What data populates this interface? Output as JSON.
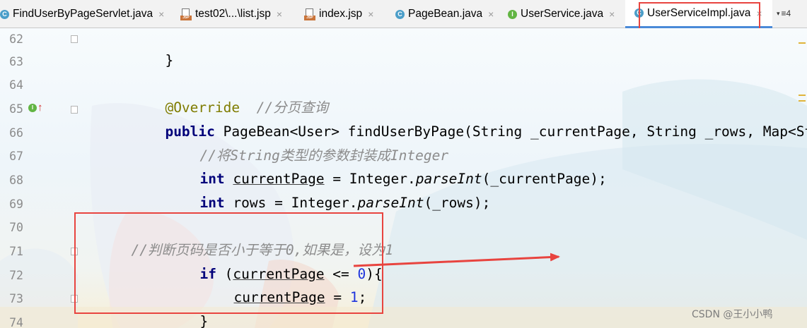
{
  "tabs": [
    {
      "label": "FindUserByPageServlet.java",
      "icon": "class-icon",
      "close": "×"
    },
    {
      "label": "test02\\...\\list.jsp",
      "icon": "jsp-file-icon",
      "close": "×"
    },
    {
      "label": "index.jsp",
      "icon": "jsp-file-icon",
      "close": "×"
    },
    {
      "label": "PageBean.java",
      "icon": "class-icon",
      "close": "×"
    },
    {
      "label": "UserService.java",
      "icon": "interface-icon",
      "close": "×"
    },
    {
      "label": "UserServiceImpl.java",
      "icon": "class-icon",
      "close": "×",
      "active": true
    }
  ],
  "tab_overflow": "≡4",
  "icon_letters": {
    "class": "C",
    "interface": "I",
    "jsp": "JSP"
  },
  "line_numbers": [
    "62",
    "63",
    "64",
    "65",
    "66",
    "67",
    "68",
    "69",
    "70",
    "71",
    "72",
    "73",
    "74"
  ],
  "code": {
    "l62": "}",
    "l64_ann": "@Override",
    "l64_cmt": "//分页查询",
    "l65_kw": "public",
    "l65_rest": " PageBean<User> findUserByPage(String _currentPage, String _rows, Map<String",
    "l66": "//将String类型的参数封装成Integer",
    "l67_kw": "int",
    "l67_var": "currentPage",
    "l67_a": " = Integer.",
    "l67_m": "parseInt",
    "l67_b": "(_currentPage);",
    "l68_kw": "int",
    "l68_a": " rows = Integer.",
    "l68_m": "parseInt",
    "l68_b": "(_rows);",
    "l70": "//判断页码是否小于等于0,如果是，设为1",
    "l71_kw": "if",
    "l71_a": " (",
    "l71_var": "currentPage",
    "l71_b": " <= ",
    "l71_num": "0",
    "l71_c": "){",
    "l72_var": "currentPage",
    "l72_a": " = ",
    "l72_num": "1",
    "l72_b": ";",
    "l73": "}"
  },
  "watermark": "CSDN @王小小鸭",
  "colors": {
    "keyword": "#00007a",
    "annotation": "#7f7c00",
    "comment": "#8c8c8c",
    "number": "#1d33dd",
    "highlight_red": "#e8443f",
    "active_tab_underline": "#4a8ad8"
  }
}
